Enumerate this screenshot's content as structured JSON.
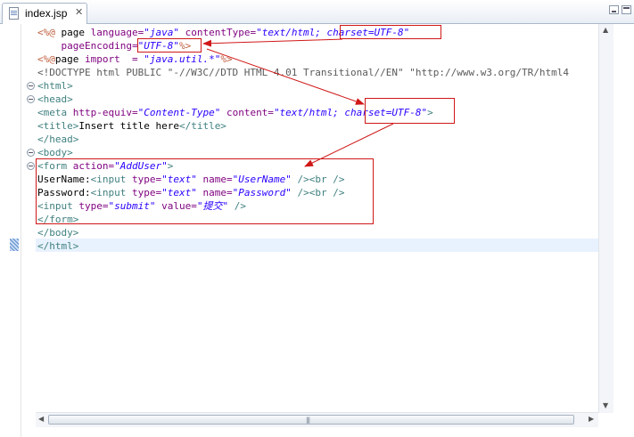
{
  "tab": {
    "title": "index.jsp",
    "close": "✕"
  },
  "code_lines": [
    {
      "fold": false,
      "tokens": [
        {
          "t": "<%@ ",
          "c": "dir"
        },
        {
          "t": "page ",
          "c": "pl"
        },
        {
          "t": "language=",
          "c": "attr"
        },
        {
          "t": "\"java\"",
          "c": "val"
        },
        {
          "t": " contentType=",
          "c": "attr"
        },
        {
          "t": "\"text/html; charset=UTF-8\"",
          "c": "val"
        }
      ]
    },
    {
      "fold": false,
      "tokens": [
        {
          "t": "    pageEncoding=",
          "c": "attr"
        },
        {
          "t": "\"UTF-8\"",
          "c": "val"
        },
        {
          "t": "%>",
          "c": "dir"
        }
      ]
    },
    {
      "fold": false,
      "tokens": [
        {
          "t": "<%@",
          "c": "dir"
        },
        {
          "t": "page ",
          "c": "pl"
        },
        {
          "t": "import  = ",
          "c": "attr"
        },
        {
          "t": "\"java.util.*\"",
          "c": "val"
        },
        {
          "t": "%>",
          "c": "dir"
        }
      ]
    },
    {
      "fold": false,
      "tokens": [
        {
          "t": "<!DOCTYPE html PUBLIC \"-//W3C//DTD HTML 4.01 Transitional//EN\" \"http://www.w3.org/TR/html4",
          "c": "doc"
        }
      ]
    },
    {
      "fold": true,
      "tokens": [
        {
          "t": "<html>",
          "c": "tag"
        }
      ]
    },
    {
      "fold": true,
      "tokens": [
        {
          "t": "<head>",
          "c": "tag"
        }
      ]
    },
    {
      "fold": false,
      "tokens": [
        {
          "t": "<meta ",
          "c": "tag"
        },
        {
          "t": "http-equiv=",
          "c": "attr"
        },
        {
          "t": "\"Content-Type\"",
          "c": "val"
        },
        {
          "t": " content=",
          "c": "attr"
        },
        {
          "t": "\"text/html; charset=UTF-8\"",
          "c": "val"
        },
        {
          "t": ">",
          "c": "tag"
        }
      ]
    },
    {
      "fold": false,
      "tokens": [
        {
          "t": "<title>",
          "c": "tag"
        },
        {
          "t": "Insert title here",
          "c": "pl"
        },
        {
          "t": "</title>",
          "c": "tag"
        }
      ]
    },
    {
      "fold": false,
      "tokens": [
        {
          "t": "</head>",
          "c": "tag"
        }
      ]
    },
    {
      "fold": true,
      "tokens": [
        {
          "t": "<body>",
          "c": "tag"
        }
      ]
    },
    {
      "fold": true,
      "tokens": [
        {
          "t": "<form ",
          "c": "tag"
        },
        {
          "t": "action=",
          "c": "attr"
        },
        {
          "t": "\"AddUser\"",
          "c": "val"
        },
        {
          "t": ">",
          "c": "tag"
        }
      ]
    },
    {
      "fold": false,
      "tokens": [
        {
          "t": "UserName:",
          "c": "pl"
        },
        {
          "t": "<input ",
          "c": "tag"
        },
        {
          "t": "type=",
          "c": "attr"
        },
        {
          "t": "\"text\"",
          "c": "val"
        },
        {
          "t": " name=",
          "c": "attr"
        },
        {
          "t": "\"UserName\"",
          "c": "val"
        },
        {
          "t": " />",
          "c": "tag"
        },
        {
          "t": "<br />",
          "c": "tag"
        }
      ]
    },
    {
      "fold": false,
      "tokens": [
        {
          "t": "Password:",
          "c": "pl"
        },
        {
          "t": "<input ",
          "c": "tag"
        },
        {
          "t": "type=",
          "c": "attr"
        },
        {
          "t": "\"text\"",
          "c": "val"
        },
        {
          "t": " name=",
          "c": "attr"
        },
        {
          "t": "\"Password\"",
          "c": "val"
        },
        {
          "t": " />",
          "c": "tag"
        },
        {
          "t": "<br />",
          "c": "tag"
        }
      ]
    },
    {
      "fold": false,
      "tokens": [
        {
          "t": "<input ",
          "c": "tag"
        },
        {
          "t": "type=",
          "c": "attr"
        },
        {
          "t": "\"submit\"",
          "c": "val"
        },
        {
          "t": " value=",
          "c": "attr"
        },
        {
          "t": "\"提交\"",
          "c": "val"
        },
        {
          "t": " />",
          "c": "tag"
        }
      ]
    },
    {
      "fold": false,
      "tokens": [
        {
          "t": "</form>",
          "c": "tag"
        }
      ]
    },
    {
      "fold": false,
      "tokens": [
        {
          "t": "</body>",
          "c": "tag"
        }
      ]
    },
    {
      "fold": false,
      "tokens": [
        {
          "t": "</html>",
          "c": "tag"
        }
      ]
    }
  ],
  "colors": {
    "annotation": "#d01717",
    "directive": "#bf5f3f",
    "attribute": "#7f007f",
    "value": "#2a00ff",
    "tag": "#3f7f7f",
    "current_line": "#e8f2fe"
  },
  "icons": {
    "tab": "jsp-file-icon",
    "fold": "fold-toggle-icon",
    "close": "close-icon",
    "minimize": "minimize-icon",
    "maximize": "maximize-icon"
  }
}
